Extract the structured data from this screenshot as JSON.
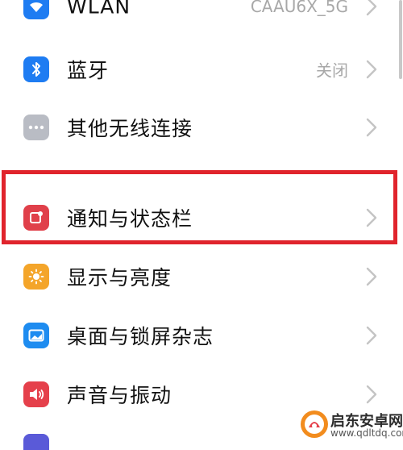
{
  "settings": {
    "items": [
      {
        "label": "WLAN",
        "value": "CAAU6X_5G",
        "icon": "wifi-icon",
        "color": "#1e7cf2"
      },
      {
        "label": "蓝牙",
        "value": "关闭",
        "icon": "bluetooth-icon",
        "color": "#1e7cf2"
      },
      {
        "label": "其他无线连接",
        "value": "",
        "icon": "more-dots-icon",
        "color": "#b9bcc4"
      },
      {
        "label": "通知与状态栏",
        "value": "",
        "icon": "notification-icon",
        "color": "#e0404a"
      },
      {
        "label": "显示与亮度",
        "value": "",
        "icon": "brightness-icon",
        "color": "#f4a52a"
      },
      {
        "label": "桌面与锁屏杂志",
        "value": "",
        "icon": "wallpaper-icon",
        "color": "#1e8cf0"
      },
      {
        "label": "声音与振动",
        "value": "",
        "icon": "speaker-icon",
        "color": "#e5404b"
      }
    ]
  },
  "highlight_color": "#e0242c",
  "watermark": {
    "title": "启东安卓网",
    "url": "www.qdltdq.com"
  }
}
